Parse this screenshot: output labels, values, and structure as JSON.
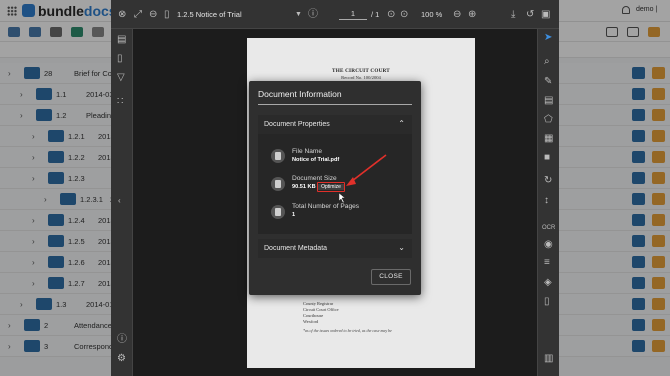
{
  "app": {
    "logo_text_a": "bundle",
    "logo_text_b": "docs",
    "user": "demo |"
  },
  "index": {
    "rows": [
      {
        "num": "28",
        "title": "Brief for Counsel"
      },
      {
        "num": "1.1",
        "title": "2014-03-07"
      },
      {
        "num": "1.2",
        "title": "Pleadings"
      },
      {
        "num": "1.2.1",
        "title": "2013-07-"
      },
      {
        "num": "1.2.2",
        "title": "2013-07-"
      },
      {
        "num": "1.2.3",
        "title": ""
      },
      {
        "num": "1.2.3.1",
        "title": "2013-0"
      },
      {
        "num": "1.2.4",
        "title": "2013-07-"
      },
      {
        "num": "1.2.5",
        "title": "2013-07-"
      },
      {
        "num": "1.2.6",
        "title": "2015-03-"
      },
      {
        "num": "1.2.7",
        "title": "2015-02-"
      },
      {
        "num": "1.3",
        "title": "2014-01"
      },
      {
        "num": "2",
        "title": "Attendance and"
      },
      {
        "num": "3",
        "title": "Correspondence"
      }
    ]
  },
  "viewer": {
    "title": "1.2.5 Notice of Trial",
    "page_current": "1",
    "page_total": "/ 1",
    "zoom": "100 %",
    "court": "THE CIRCUIT COURT",
    "record_no": "Record No. 100/2004",
    "address_lines": [
      "County Registrar",
      "Circuit Court Office",
      "Courthouse",
      "Wexford"
    ],
    "footnote": "*as of the issues ordered to be tried, as the case may be"
  },
  "modal": {
    "title": "Document Information",
    "section_properties": "Document Properties",
    "file_name_label": "File Name",
    "file_name_value": "Notice of Trial.pdf",
    "doc_size_label": "Document Size",
    "doc_size_value": "90.51 KB",
    "optimize_label": "Optimize",
    "pages_label": "Total Number of Pages",
    "pages_value": "1",
    "section_metadata": "Document Metadata",
    "close_label": "CLOSE"
  },
  "colors": {
    "accent_blue": "#2f6fa8",
    "annotation_red": "#e0302a"
  }
}
